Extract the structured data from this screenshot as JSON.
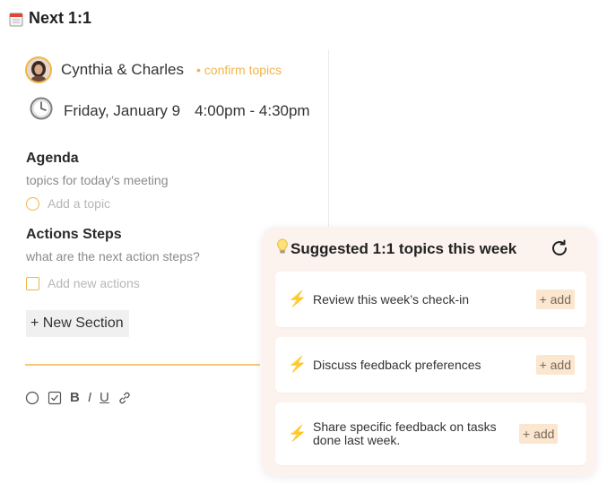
{
  "page": {
    "title": "Next 1:1"
  },
  "meeting": {
    "participants": "Cynthia & Charles",
    "confirm_label": "• confirm topics",
    "date": "Friday, January 9",
    "time_range": "4:00pm - 4:30pm"
  },
  "agenda": {
    "heading": "Agenda",
    "subtitle": "topics for today’s meeting",
    "placeholder": "Add a topic"
  },
  "actions": {
    "heading": "Actions Steps",
    "subtitle": "what are the next action steps?",
    "placeholder": "Add new actions"
  },
  "new_section_label": "+ New Section",
  "toolbar": {
    "bold": "B",
    "italic": "I",
    "underline": "U"
  },
  "suggested": {
    "title": "Suggested 1:1 topics this week",
    "items": [
      {
        "text": "Review this week’s check-in",
        "add_label": "+ add"
      },
      {
        "text": "Discuss feedback preferences",
        "add_label": "+ add"
      },
      {
        "text": "Share specific feedback on tasks done last week.",
        "add_label": "+ add"
      }
    ]
  },
  "colors": {
    "accent": "#f1b545",
    "card_bg": "#fdf3ee",
    "add_bg": "#fbe6cf"
  },
  "icons": [
    "calendar-icon",
    "clock-icon",
    "lightbulb-icon",
    "refresh-icon",
    "lightning-icon",
    "link-icon"
  ]
}
